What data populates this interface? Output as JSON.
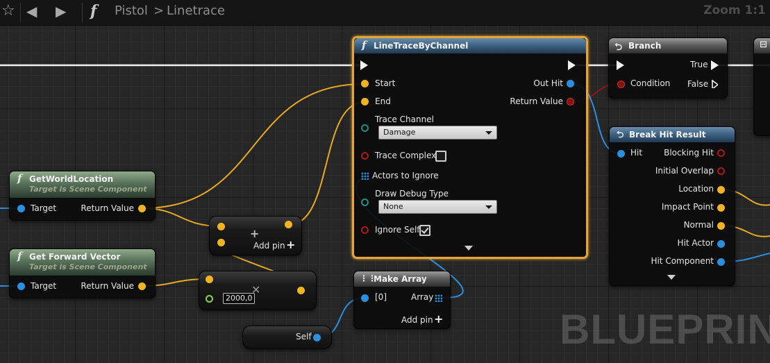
{
  "toolbar": {
    "breadcrumb_root": "Pistol",
    "breadcrumb_sep": ">",
    "breadcrumb_current": "Linetrace",
    "zoom": "Zoom 1:1",
    "icons": [
      "star-icon",
      "back-arrow-icon",
      "forward-arrow-icon",
      "function-icon"
    ]
  },
  "nodes": {
    "linetrace": {
      "title": "LineTraceByChannel",
      "inputs": {
        "start": "Start",
        "end": "End",
        "trace_channel": "Trace Channel",
        "trace_complex": "Trace Complex",
        "actors_to_ignore": "Actors to Ignore",
        "draw_debug_type": "Draw Debug Type",
        "ignore_self": "Ignore Self"
      },
      "outputs": {
        "out_hit": "Out Hit",
        "return_value": "Return Value"
      },
      "trace_channel_value": "Damage",
      "draw_debug_value": "None",
      "trace_complex_checked": false,
      "ignore_self_checked": true
    },
    "branch": {
      "title": "Branch",
      "condition": "Condition",
      "true_label": "True",
      "false_label": "False"
    },
    "break_hit": {
      "title": "Break Hit Result",
      "input": "Hit",
      "outputs": [
        "Blocking Hit",
        "Initial Overlap",
        "Location",
        "Impact Point",
        "Normal",
        "Hit Actor",
        "Hit Component"
      ]
    },
    "get_world_location": {
      "title": "GetWorldLocation",
      "subtitle": "Target is Scene Component",
      "target": "Target",
      "return_value": "Return Value"
    },
    "get_forward_vector": {
      "title": "Get Forward Vector",
      "subtitle": "Target is Scene Component",
      "target": "Target",
      "return_value": "Return Value"
    },
    "add": {
      "add_pin": "Add pin"
    },
    "multiply": {
      "value": "2000,0"
    },
    "make_array": {
      "title": "Make Array",
      "item0": "[0]",
      "array": "Array",
      "add_pin": "Add pin"
    },
    "self": {
      "label": "Self"
    }
  },
  "watermark": "BLUEPRINT",
  "colors": {
    "exec": "#f2f2f2",
    "vector": "#f2b420",
    "object": "#2a8fdf",
    "bool": "#8a1010",
    "selection": "#e8a437"
  }
}
